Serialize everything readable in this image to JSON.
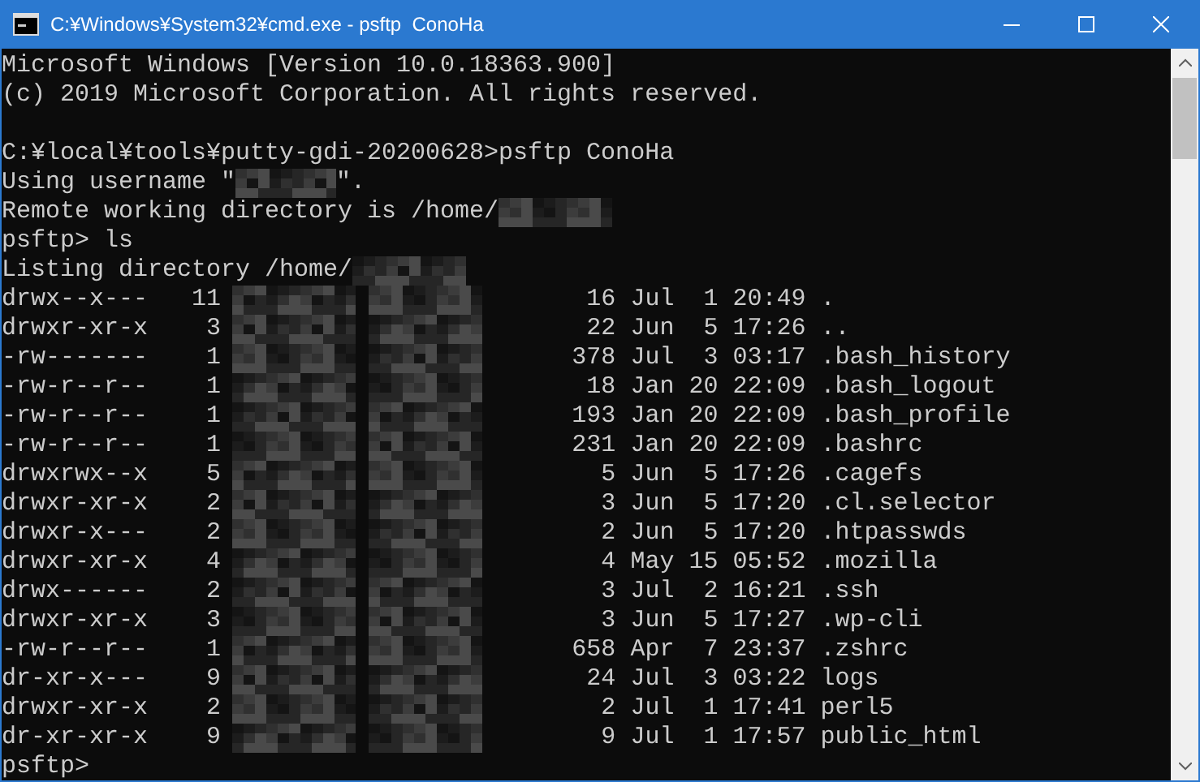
{
  "window": {
    "title": "C:¥Windows¥System32¥cmd.exe - psftp  ConoHa"
  },
  "console": {
    "lines": [
      {
        "kind": "text",
        "text": "Microsoft Windows [Version 10.0.18363.900]"
      },
      {
        "kind": "text",
        "text": "(c) 2019 Microsoft Corporation. All rights reserved."
      },
      {
        "kind": "blank"
      },
      {
        "kind": "text",
        "text": "C:¥local¥tools¥putty-gdi-20200628>psftp ConoHa"
      },
      {
        "kind": "redacted",
        "before": "Using username \"",
        "after": "\"."
      },
      {
        "kind": "redacted",
        "before": "Remote working directory is /home/"
      },
      {
        "kind": "text",
        "text": "psftp> ls"
      },
      {
        "kind": "redacted",
        "before": "Listing directory /home/"
      }
    ],
    "listing": [
      {
        "perms": "drwx--x---",
        "links": "11",
        "size": "16",
        "month": "Jul",
        "day": "1",
        "time": "20:49",
        "name": "."
      },
      {
        "perms": "drwxr-xr-x",
        "links": "3",
        "size": "22",
        "month": "Jun",
        "day": "5",
        "time": "17:26",
        "name": ".."
      },
      {
        "perms": "-rw-------",
        "links": "1",
        "size": "378",
        "month": "Jul",
        "day": "3",
        "time": "03:17",
        "name": ".bash_history"
      },
      {
        "perms": "-rw-r--r--",
        "links": "1",
        "size": "18",
        "month": "Jan",
        "day": "20",
        "time": "22:09",
        "name": ".bash_logout"
      },
      {
        "perms": "-rw-r--r--",
        "links": "1",
        "size": "193",
        "month": "Jan",
        "day": "20",
        "time": "22:09",
        "name": ".bash_profile"
      },
      {
        "perms": "-rw-r--r--",
        "links": "1",
        "size": "231",
        "month": "Jan",
        "day": "20",
        "time": "22:09",
        "name": ".bashrc"
      },
      {
        "perms": "drwxrwx--x",
        "links": "5",
        "size": "5",
        "month": "Jun",
        "day": "5",
        "time": "17:26",
        "name": ".cagefs"
      },
      {
        "perms": "drwxr-xr-x",
        "links": "2",
        "size": "3",
        "month": "Jun",
        "day": "5",
        "time": "17:20",
        "name": ".cl.selector"
      },
      {
        "perms": "drwxr-x---",
        "links": "2",
        "size": "2",
        "month": "Jun",
        "day": "5",
        "time": "17:20",
        "name": ".htpasswds"
      },
      {
        "perms": "drwxr-xr-x",
        "links": "4",
        "size": "4",
        "month": "May",
        "day": "15",
        "time": "05:52",
        "name": ".mozilla"
      },
      {
        "perms": "drwx------",
        "links": "2",
        "size": "3",
        "month": "Jul",
        "day": "2",
        "time": "16:21",
        "name": ".ssh"
      },
      {
        "perms": "drwxr-xr-x",
        "links": "3",
        "size": "3",
        "month": "Jun",
        "day": "5",
        "time": "17:27",
        "name": ".wp-cli"
      },
      {
        "perms": "-rw-r--r--",
        "links": "1",
        "size": "658",
        "month": "Apr",
        "day": "7",
        "time": "23:37",
        "name": ".zshrc"
      },
      {
        "perms": "dr-xr-x---",
        "links": "9",
        "size": "24",
        "month": "Jul",
        "day": "3",
        "time": "03:22",
        "name": "logs"
      },
      {
        "perms": "drwxr-xr-x",
        "links": "2",
        "size": "2",
        "month": "Jul",
        "day": "1",
        "time": "17:41",
        "name": "perl5"
      },
      {
        "perms": "dr-xr-xr-x",
        "links": "9",
        "size": "9",
        "month": "Jul",
        "day": "1",
        "time": "17:57",
        "name": "public_html"
      }
    ],
    "prompt": "psftp>"
  }
}
